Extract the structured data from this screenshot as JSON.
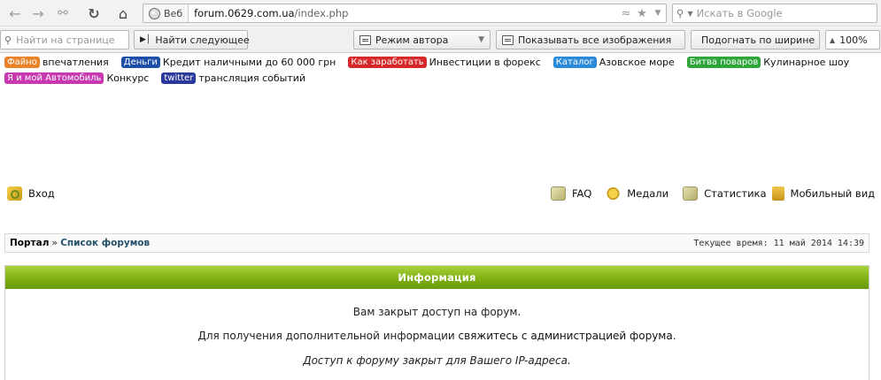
{
  "browser": {
    "identity_label": "Веб",
    "url_host": "forum.0629.com.ua",
    "url_path": "/index.php",
    "search_placeholder": "Искать в Google"
  },
  "findbar": {
    "find_placeholder": "Найти на странице",
    "find_next": "Найти следующее",
    "author_mode": "Режим автора",
    "show_images": "Показывать все изображения",
    "fit_width": "Подогнать по ширине",
    "zoom": "100%"
  },
  "promo_rows": [
    [
      {
        "tag": "Файно",
        "color": "#e8832a",
        "text": "впечатления"
      },
      {
        "tag": "Деньги",
        "color": "#1e4fa8",
        "text": "Кредит наличными до 60 000 грн"
      },
      {
        "tag": "Как заработать",
        "color": "#d62828",
        "text": "Инвестиции в форекс"
      },
      {
        "tag": "Каталог",
        "color": "#2a8ad8",
        "text": "Азовское море"
      },
      {
        "tag": "Битва поваров",
        "color": "#2ea63a",
        "text": "Кулинарное шоу"
      }
    ],
    [
      {
        "tag": "Я и мой Автомобиль",
        "color": "#c838b0",
        "text": "Конкурс"
      },
      {
        "tag": "twitter",
        "color": "#2a3a9c",
        "text": "трансляция событий"
      }
    ]
  ],
  "forum": {
    "login": "Вход",
    "faq": "FAQ",
    "medals": "Медали",
    "stats": "Статистика",
    "mobile": "Мобильный вид"
  },
  "breadcrumb": {
    "portal": "Портал",
    "sep": "»",
    "forums": "Список форумов",
    "current_time": "Текущее время: 11 май 2014 14:39"
  },
  "info": {
    "title": "Информация",
    "line1": "Вам закрыт доступ на форум.",
    "line2_pre": "Для получения дополнительной информации ",
    "line2_hl": "свяжитесь с администрацией форума",
    "line2_post": ".",
    "line3": "Доступ к форуму закрыт для Вашего IP-адреса."
  }
}
